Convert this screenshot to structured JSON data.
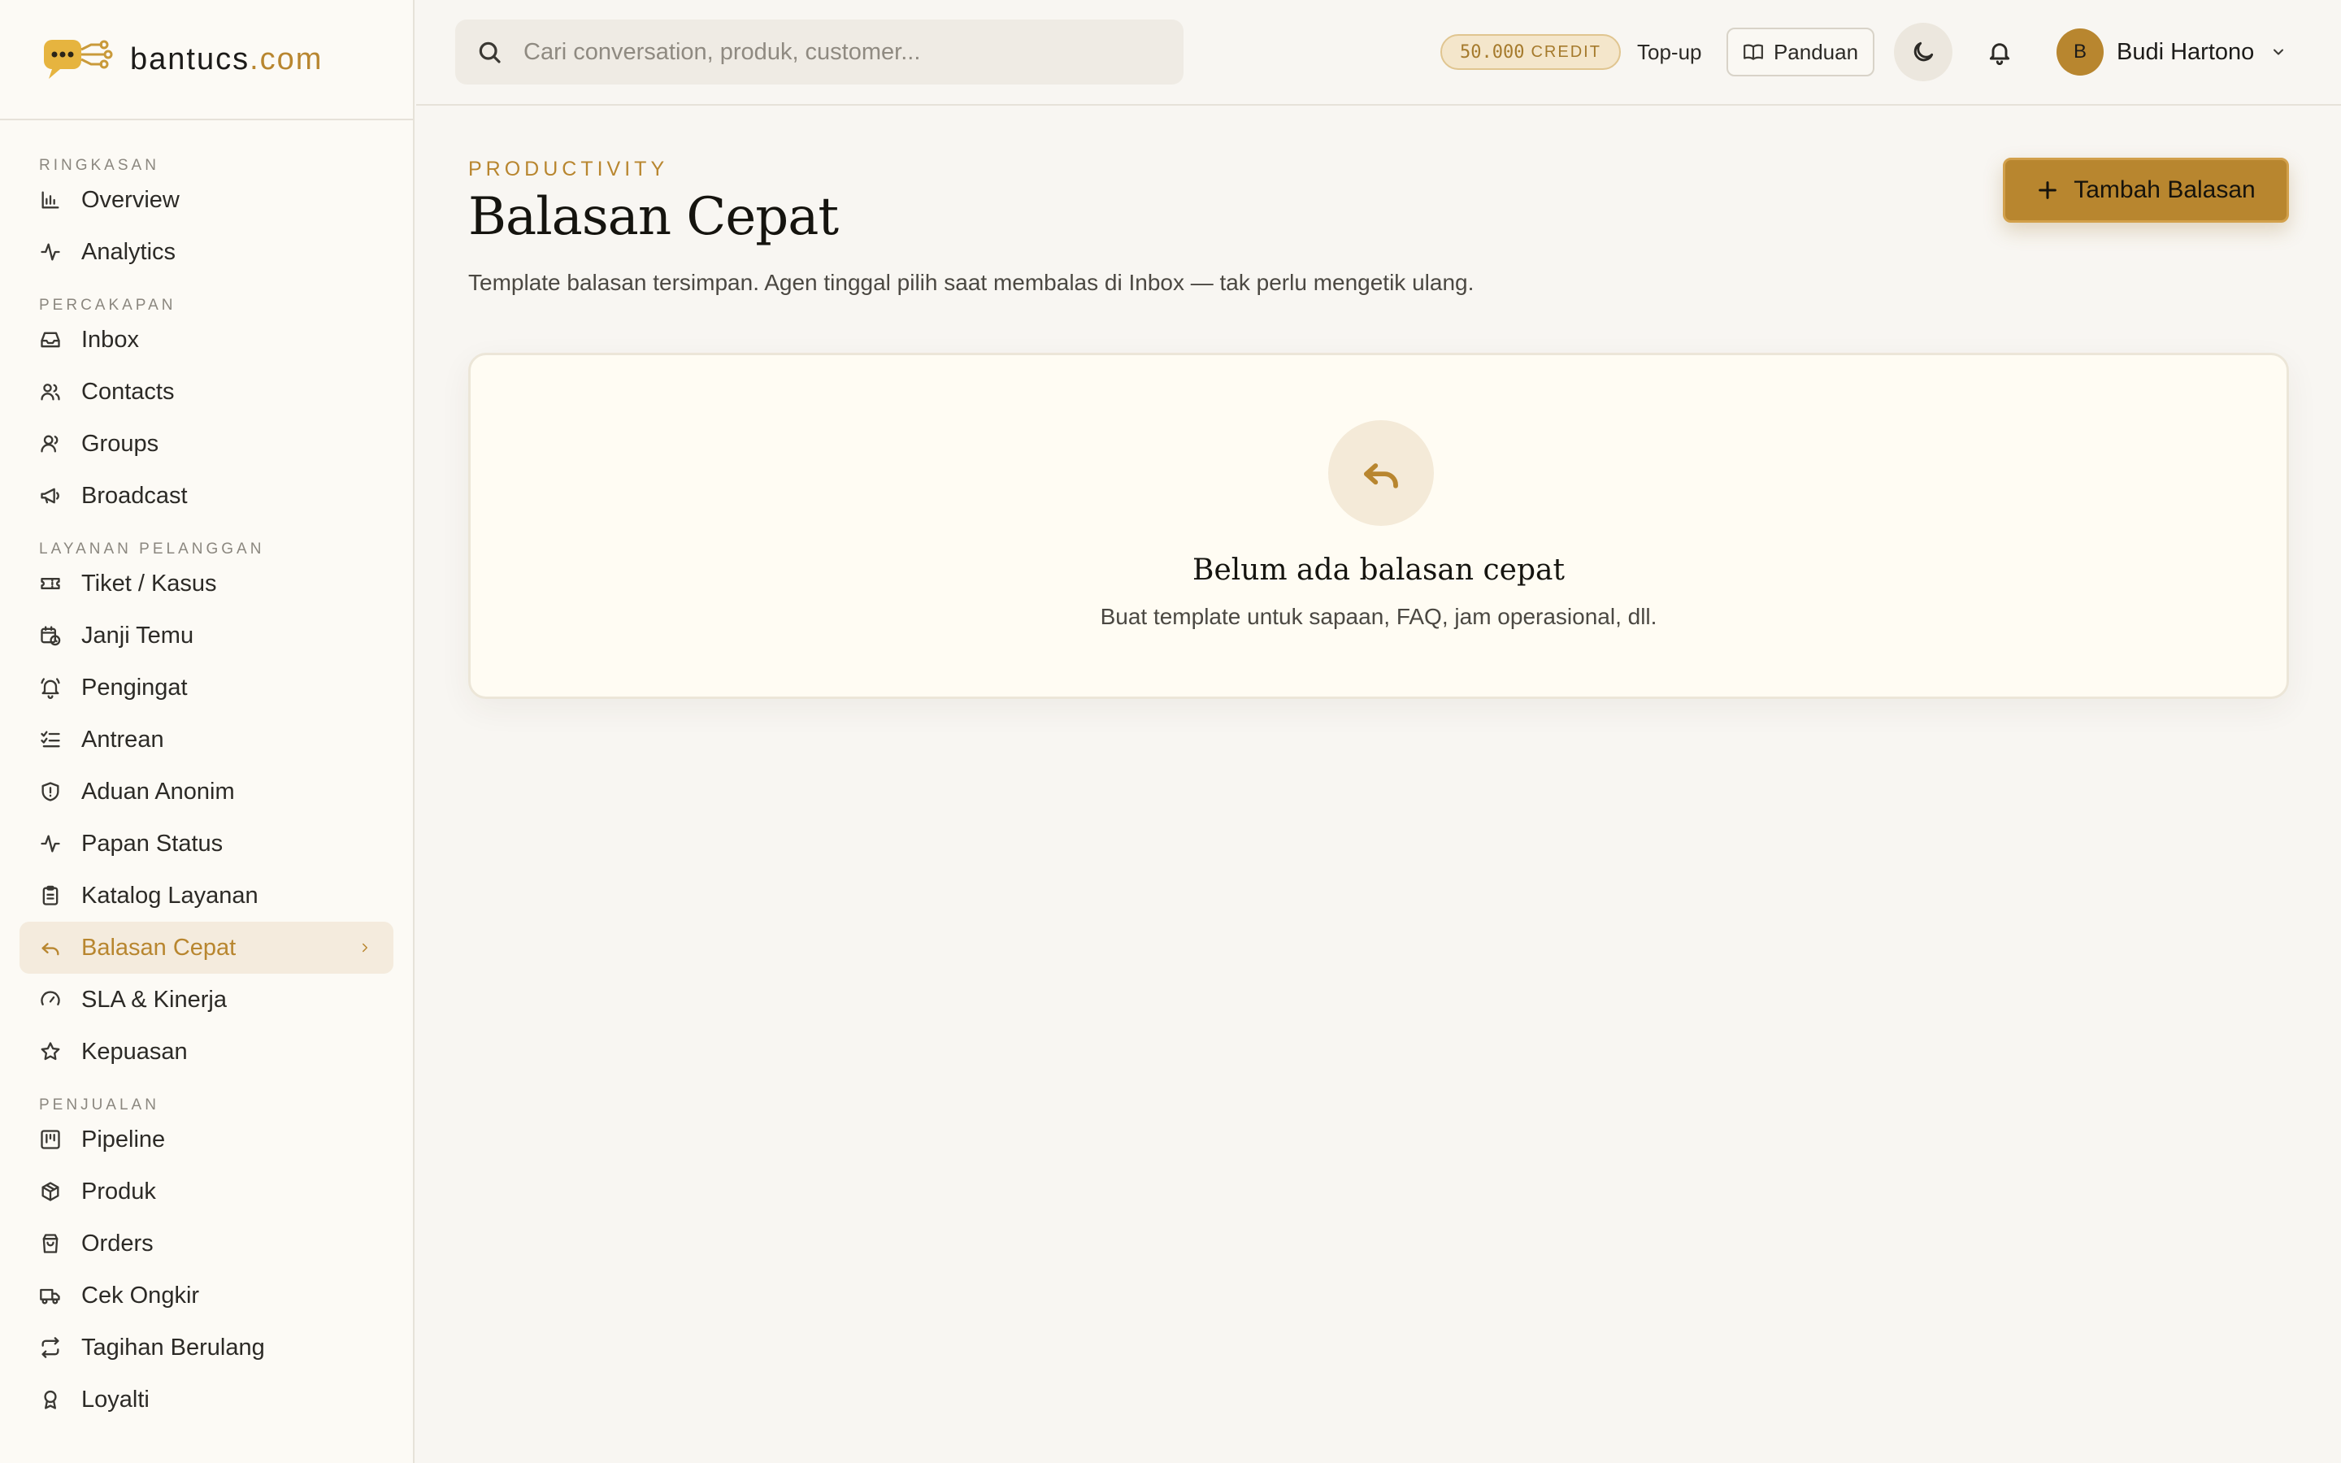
{
  "brand": {
    "name": "bantucs",
    "tld": ".com"
  },
  "sidebar": {
    "sections": [
      {
        "title": "RINGKASAN",
        "items": [
          {
            "label": "Overview",
            "icon": "bar-chart-icon"
          },
          {
            "label": "Analytics",
            "icon": "activity-icon"
          }
        ]
      },
      {
        "title": "PERCAKAPAN",
        "items": [
          {
            "label": "Inbox",
            "icon": "inbox-icon"
          },
          {
            "label": "Contacts",
            "icon": "users-icon"
          },
          {
            "label": "Groups",
            "icon": "user-group-icon"
          },
          {
            "label": "Broadcast",
            "icon": "megaphone-icon"
          }
        ]
      },
      {
        "title": "LAYANAN PELANGGAN",
        "items": [
          {
            "label": "Tiket / Kasus",
            "icon": "ticket-icon"
          },
          {
            "label": "Janji Temu",
            "icon": "calendar-clock-icon"
          },
          {
            "label": "Pengingat",
            "icon": "bell-ring-icon"
          },
          {
            "label": "Antrean",
            "icon": "list-checks-icon"
          },
          {
            "label": "Aduan Anonim",
            "icon": "shield-alert-icon"
          },
          {
            "label": "Papan Status",
            "icon": "pulse-icon"
          },
          {
            "label": "Katalog Layanan",
            "icon": "clipboard-list-icon"
          },
          {
            "label": "Balasan Cepat",
            "icon": "reply-icon",
            "active": true
          },
          {
            "label": "SLA & Kinerja",
            "icon": "gauge-icon"
          },
          {
            "label": "Kepuasan",
            "icon": "star-icon"
          }
        ]
      },
      {
        "title": "PENJUALAN",
        "items": [
          {
            "label": "Pipeline",
            "icon": "kanban-icon"
          },
          {
            "label": "Produk",
            "icon": "package-icon"
          },
          {
            "label": "Orders",
            "icon": "shopping-bag-icon"
          },
          {
            "label": "Cek Ongkir",
            "icon": "truck-icon"
          },
          {
            "label": "Tagihan Berulang",
            "icon": "repeat-icon"
          },
          {
            "label": "Loyalti",
            "icon": "award-icon"
          }
        ]
      }
    ]
  },
  "topbar": {
    "search_placeholder": "Cari conversation, produk, customer...",
    "credit_amount": "50.000",
    "credit_label": "CREDIT",
    "topup_label": "Top-up",
    "guide_label": "Panduan",
    "user_initial": "B",
    "user_name": "Budi Hartono"
  },
  "main": {
    "eyebrow": "PRODUCTIVITY",
    "title": "Balasan Cepat",
    "description": "Template balasan tersimpan. Agen tinggal pilih saat membalas di Inbox — tak perlu mengetik ulang.",
    "add_button_label": "Tambah Balasan",
    "empty_state": {
      "title": "Belum ada balasan cepat",
      "description": "Buat template untuk sapaan, FAQ, jam operasional, dll."
    }
  },
  "colors": {
    "accent": "#b8862f",
    "active_bg": "#f4ebdd",
    "page_bg": "#f8f6f2",
    "card_bg": "#fffcf3"
  }
}
